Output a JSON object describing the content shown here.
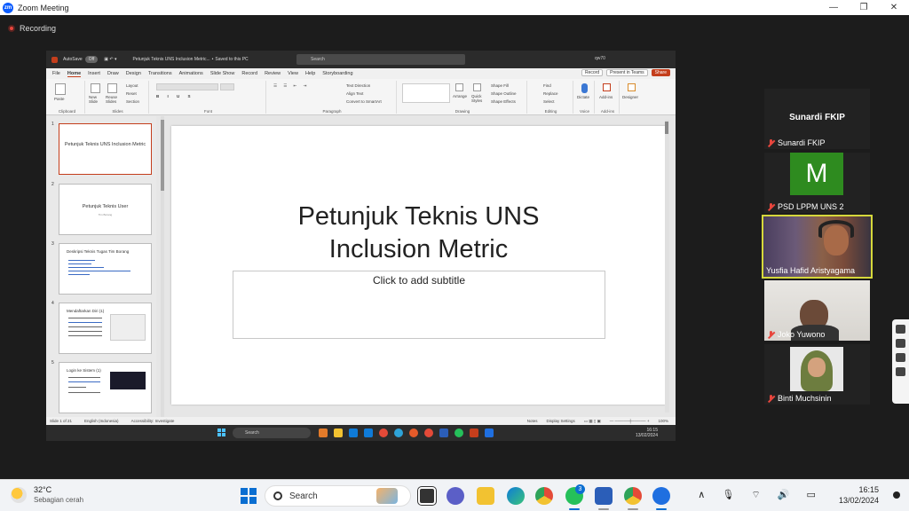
{
  "zoom": {
    "title": "Zoom Meeting",
    "logo": "zm",
    "recording": "Recording",
    "window_controls": [
      "—",
      "❐",
      "✕"
    ]
  },
  "ppt": {
    "file_title": "Petunjuk Teknis UNS Inclusion Metric...",
    "saved_state": "Saved to this PC",
    "autosave_label": "AutoSave",
    "autosave_state": "Off",
    "search_placeholder": "Search",
    "user": "qw70",
    "menu": [
      "File",
      "Home",
      "Insert",
      "Draw",
      "Design",
      "Transitions",
      "Animations",
      "Slide Show",
      "Record",
      "Review",
      "View",
      "Help",
      "Storyboarding"
    ],
    "active_menu": "Home",
    "menu_buttons": {
      "record": "Record",
      "present": "Present in Teams",
      "share": "Share"
    },
    "ribbon": {
      "groups": [
        "Clipboard",
        "Slides",
        "Font",
        "Paragraph",
        "Drawing",
        "Editing",
        "Voice",
        "Add-ins"
      ],
      "paste": "Paste",
      "new_slide": "New Slide",
      "reuse_slides": "Reuse Slides",
      "layout": "Layout",
      "reset": "Reset",
      "section": "Section",
      "text_direction": "Text Direction",
      "align_text": "Align Text",
      "smartart": "Convert to SmartArt",
      "arrange": "Arrange",
      "quick_styles": "Quick Styles",
      "shape_fill": "Shape Fill",
      "shape_outline": "Shape Outline",
      "shape_effects": "Shape Effects",
      "find": "Find",
      "replace": "Replace",
      "select": "Select",
      "dictate": "Dictate",
      "add_ins": "Add-ins",
      "designer": "Designer"
    },
    "thumbnails": [
      {
        "num": "1",
        "title": "Petunjuk Teknis UNS Inclusion Metric",
        "small": ""
      },
      {
        "num": "2",
        "title": "Petunjuk Teknis User",
        "small": "Tim Borang"
      },
      {
        "num": "3",
        "title": "Deskripsi Teknis Tugas Tim Borang",
        "small": ""
      },
      {
        "num": "4",
        "title": "Mendaftarkan Diri (1)",
        "small": ""
      },
      {
        "num": "5",
        "title": "Login ke Sistem (1)",
        "small": ""
      }
    ],
    "slide": {
      "title_line1": "Petunjuk Teknis UNS",
      "title_line2": "Inclusion Metric",
      "subtitle_placeholder": "Click to add subtitle"
    },
    "status": {
      "slide_of": "Slide 1 of 21",
      "language": "English (Indonesia)",
      "accessibility": "Accessibility: Investigate",
      "notes": "Notes",
      "display_settings": "Display Settings",
      "zoom": "100%"
    },
    "inner_taskbar": {
      "search": "Search",
      "time": "16:15",
      "date": "13/02/2024"
    }
  },
  "participants": [
    {
      "name": "Sunardi FKIP",
      "display": "Sunardi FKIP",
      "muted": true,
      "type": "name-only"
    },
    {
      "name": "PSD LPPM UNS 2",
      "avatar_letter": "M",
      "muted": true,
      "type": "avatar"
    },
    {
      "name": "Yusfia Hafid Aristyagama",
      "muted": false,
      "type": "video",
      "active": true
    },
    {
      "name": "Joko Yuwono",
      "muted": true,
      "type": "video"
    },
    {
      "name": "Binti Muchsinin",
      "muted": true,
      "type": "video"
    }
  ],
  "taskbar": {
    "weather_temp": "32°C",
    "weather_desc": "Sebagian cerah",
    "search": "Search",
    "whatsapp_badge": "3",
    "time": "16:15",
    "date": "13/02/2024",
    "tray_icons": "∧ 🎙 ⌔ 🔊 ▭"
  }
}
